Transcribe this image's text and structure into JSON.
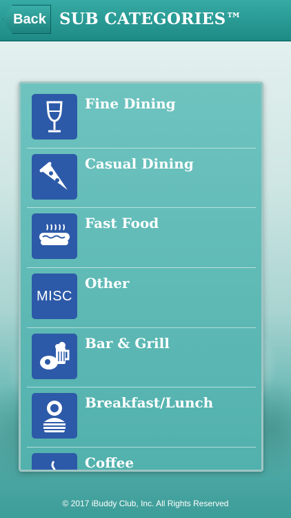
{
  "header": {
    "back_label": "Back",
    "title": "SUB CATEGORIES™"
  },
  "categories": [
    {
      "label": "Fine Dining",
      "icon": "wine-glass-icon"
    },
    {
      "label": "Casual Dining",
      "icon": "pizza-slice-icon"
    },
    {
      "label": "Fast Food",
      "icon": "hot-dog-icon"
    },
    {
      "label": "Other",
      "icon": "misc-icon",
      "icon_text": "MISC"
    },
    {
      "label": "Bar & Grill",
      "icon": "steak-beer-icon"
    },
    {
      "label": "Breakfast/Lunch",
      "icon": "breakfast-burger-icon"
    },
    {
      "label": "Coffee",
      "icon": "coffee-cup-icon"
    }
  ],
  "footer": {
    "copyright": "© 2017 iBuddy Club, Inc. All Rights Reserved"
  },
  "colors": {
    "header": "#1e8b86",
    "icon_bg": "#2d5aa8",
    "panel": "#5fb8b4"
  }
}
